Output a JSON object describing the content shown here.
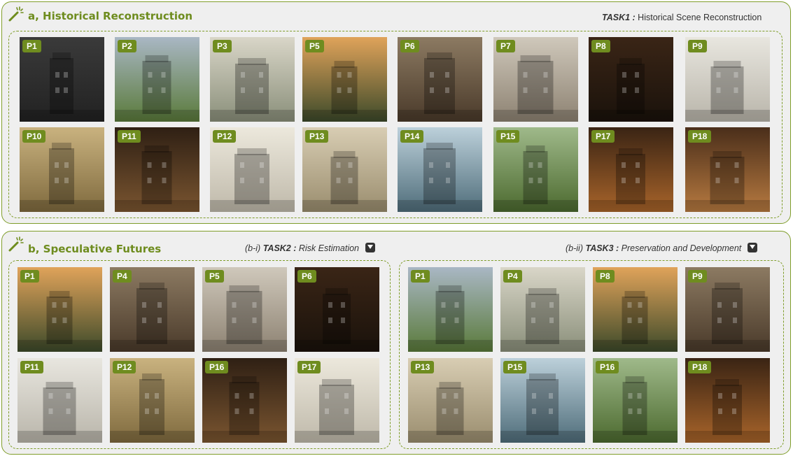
{
  "panel_a": {
    "title": "a, Historical Reconstruction",
    "task": {
      "name": "TASK1 :",
      "desc": "Historical Scene Reconstruction"
    },
    "row1": [
      "P1",
      "P2",
      "P3",
      "P5",
      "P6",
      "P7",
      "P8",
      "P9"
    ],
    "row2": [
      "P10",
      "P11",
      "P12",
      "P13",
      "P14",
      "P15",
      "P17",
      "P18"
    ]
  },
  "panel_b": {
    "title": "b, Speculative Futures",
    "task2": {
      "prefix": "(b-i)",
      "name": "TASK2 :",
      "desc": "Risk Estimation"
    },
    "task3": {
      "prefix": "(b-ii)",
      "name": "TASK3 :",
      "desc": "Preservation and Development"
    },
    "left_row1": [
      "P1",
      "P4",
      "P5",
      "P6"
    ],
    "left_row2": [
      "P11",
      "P12",
      "P16",
      "P17"
    ],
    "right_row1": [
      "P1",
      "P4",
      "P8",
      "P9"
    ],
    "right_row2": [
      "P13",
      "P15",
      "P16",
      "P18"
    ]
  }
}
